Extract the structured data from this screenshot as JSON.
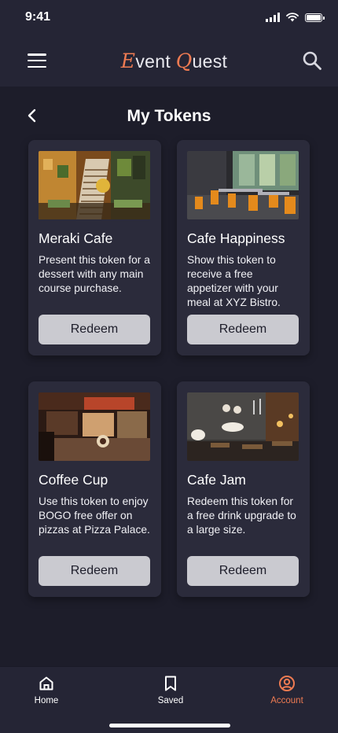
{
  "status_bar": {
    "time": "9:41",
    "battery_level": 1.0
  },
  "header": {
    "logo_e": "E",
    "logo_vent": "vent ",
    "logo_q": "Q",
    "logo_uest": "uest",
    "accent_color": "#ef7b52"
  },
  "page": {
    "title": "My Tokens"
  },
  "tokens": [
    {
      "name": "Meraki Cafe",
      "description": "Present this token for a dessert with any main course purchase.",
      "button_label": "Redeem"
    },
    {
      "name": "Cafe Happiness",
      "description": "Show this token to receive a free appetizer with your meal at XYZ Bistro.",
      "button_label": "Redeem"
    },
    {
      "name": "Coffee Cup",
      "description": "Use this token to enjoy BOGO free offer on pizzas at Pizza Palace.",
      "button_label": "Redeem"
    },
    {
      "name": "Cafe Jam",
      "description": "Redeem this token for a free drink upgrade to a large size.",
      "button_label": "Redeem"
    }
  ],
  "bottom_nav": {
    "home_label": "Home",
    "saved_label": "Saved",
    "account_label": "Account",
    "active": "Account"
  }
}
